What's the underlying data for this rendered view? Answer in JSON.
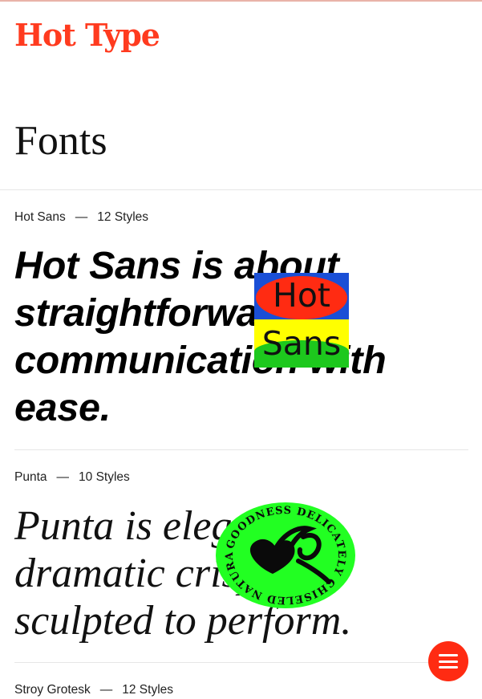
{
  "header": {
    "logo_text": "Hot Type",
    "brand_color": "#ff3b1f"
  },
  "page": {
    "title": "Fonts"
  },
  "fonts": [
    {
      "name": "Hot Sans",
      "separator": "—",
      "styles": "12 Styles",
      "sample_lines": [
        "Hot Sans is about",
        "straightforward",
        "communication with",
        "ease."
      ],
      "badge": {
        "line1": "Hot",
        "line2": "Sans",
        "colors": [
          "#ff2b12",
          "#1a4fd6",
          "#ffff00",
          "#1dc81d"
        ]
      }
    },
    {
      "name": "Punta",
      "separator": "—",
      "styles": "10 Styles",
      "sample_lines": [
        "Punta is elegant,",
        "dramatic crisp,",
        "sculpted to perform."
      ],
      "seal": {
        "ring_text": "GOODNESS DELICATELY CHISELED NATURAL",
        "color": "#22ff22"
      }
    },
    {
      "name": "Stroy Grotesk",
      "separator": "—",
      "styles": "12 Styles"
    }
  ],
  "menu": {
    "icon": "hamburger-menu-icon",
    "color": "#ff2b12"
  }
}
